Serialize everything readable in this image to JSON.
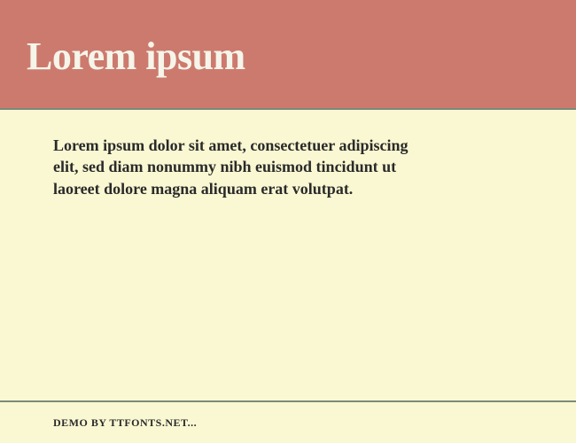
{
  "header": {
    "title": "Lorem ipsum"
  },
  "content": {
    "body_text": "Lorem ipsum dolor sit amet, consectetuer adipiscing elit, sed diam nonummy nibh euismod tincidunt ut laoreet dolore magna aliquam erat volutpat."
  },
  "footer": {
    "credit": "DEMO BY TTFONTS.NET..."
  }
}
